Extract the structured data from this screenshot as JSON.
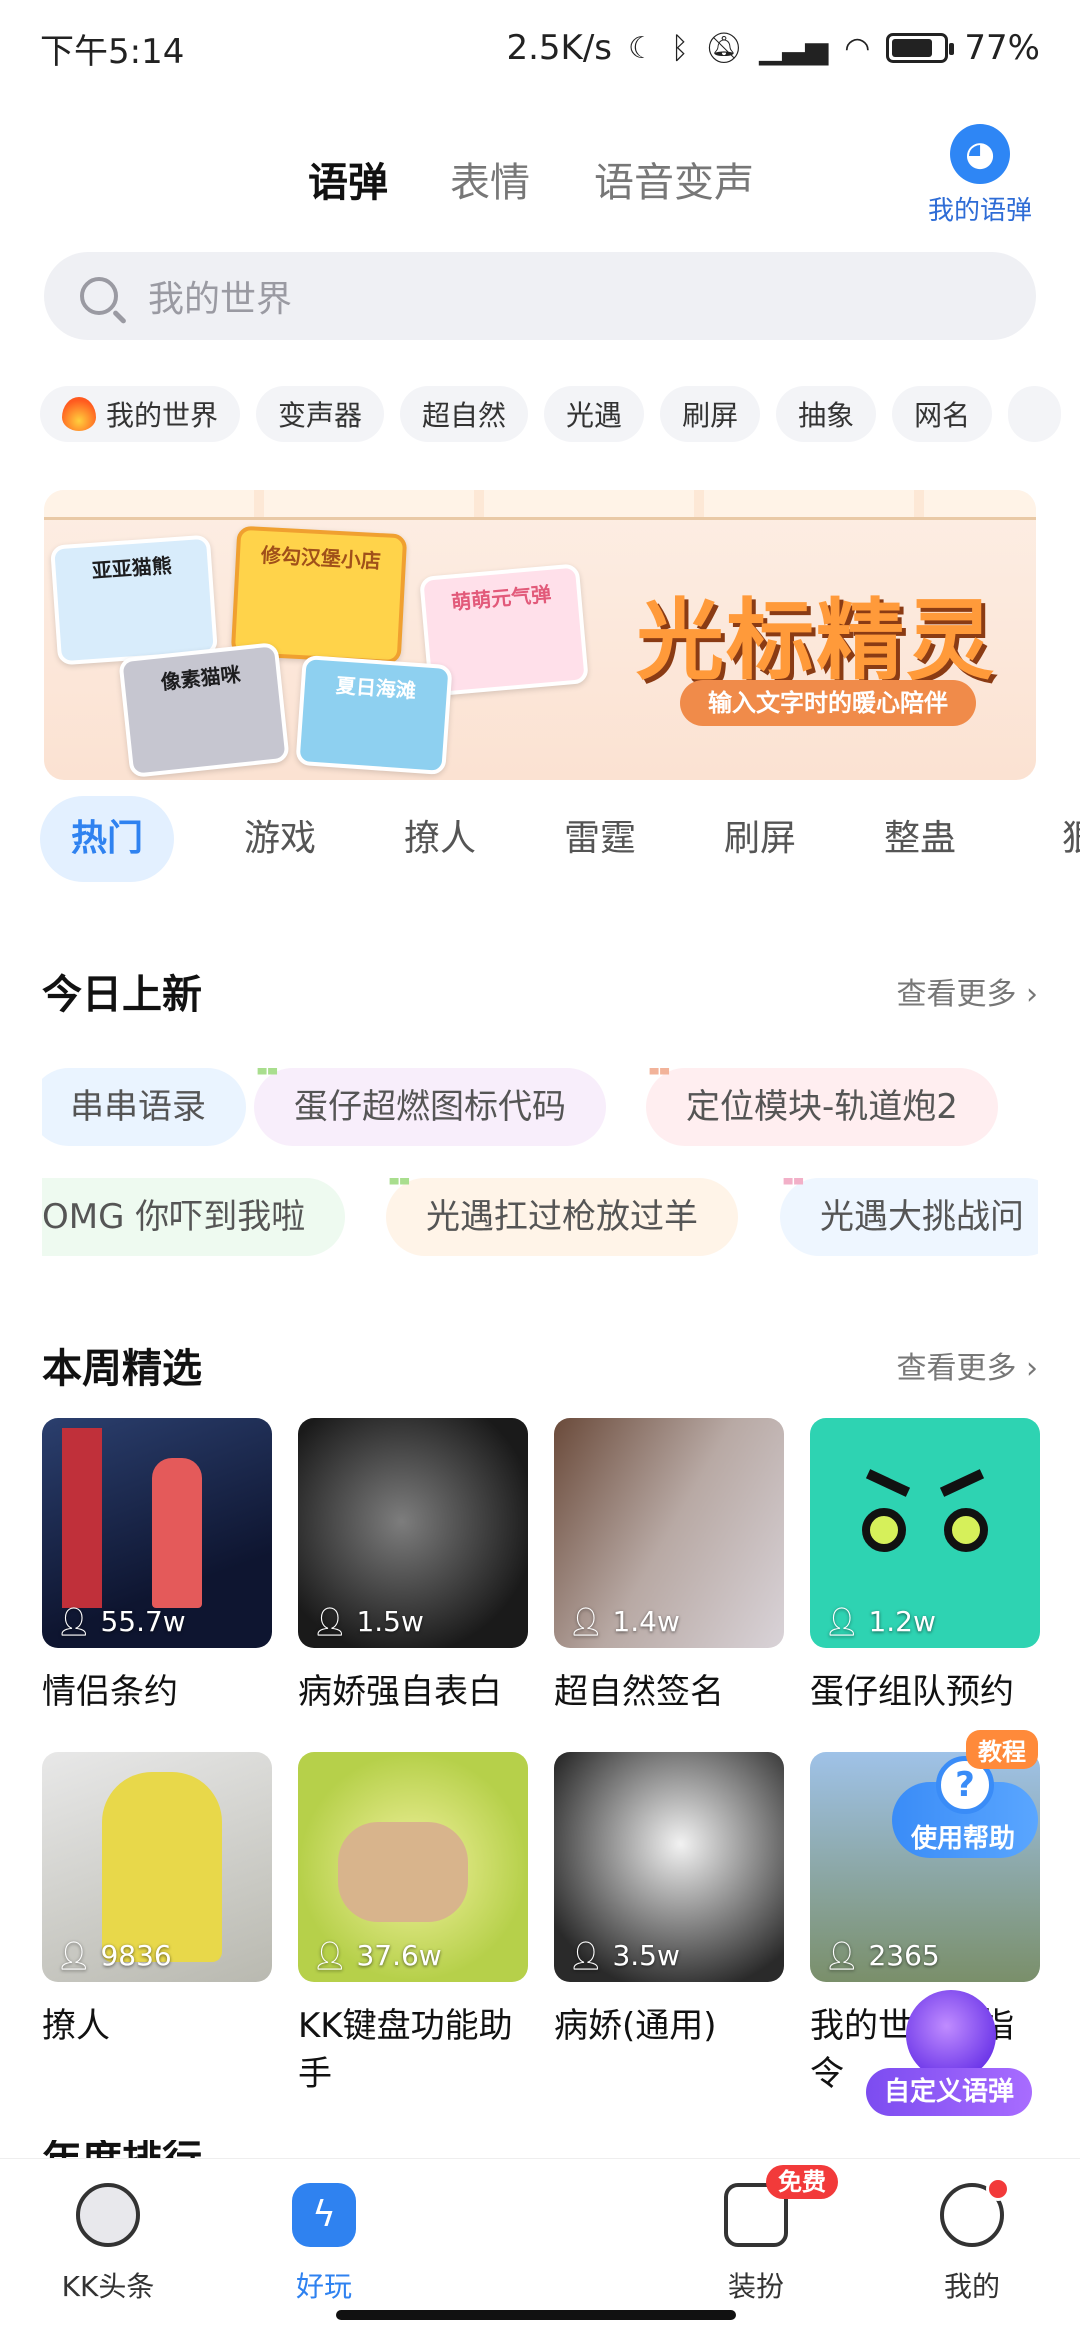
{
  "status_bar": {
    "time": "下午5:14",
    "speed": "2.5K/s",
    "battery": "77%",
    "battery_level": 0.77
  },
  "top_tabs": [
    "语弹",
    "表情",
    "语音变声"
  ],
  "my_voice_label": "我的语弹",
  "search": {
    "placeholder": "我的世界"
  },
  "chips": [
    "我的世界",
    "变声器",
    "超自然",
    "光遇",
    "刷屏",
    "抽象",
    "网名"
  ],
  "banner": {
    "title": "光标精灵",
    "subtitle": "输入文字时的暖心陪伴",
    "cards": [
      "亚亚猫熊",
      "修勾汉堡小店",
      "萌萌元气弹",
      "像素猫咪",
      "夏日海滩"
    ]
  },
  "category_tabs": [
    "热门",
    "游戏",
    "撩人",
    "雷霆",
    "刷屏",
    "整蛊",
    "狠"
  ],
  "today_new": {
    "title": "今日上新",
    "more": "查看更多",
    "row1": [
      "串串语录",
      "蛋仔超燃图标代码",
      "定位模块-轨道炮2"
    ],
    "row2": [
      "OMG 你吓到我啦",
      "光遇扛过枪放过羊",
      "光遇大挑战问"
    ]
  },
  "weekly": {
    "title": "本周精选",
    "more": "查看更多",
    "items": [
      {
        "count": "55.7w",
        "label": "情侣条约"
      },
      {
        "count": "1.5w",
        "label": "病娇强自表白"
      },
      {
        "count": "1.4w",
        "label": "超自然签名"
      },
      {
        "count": "1.2w",
        "label": "蛋仔组队预约"
      },
      {
        "count": "9836",
        "label": "撩人"
      },
      {
        "count": "37.6w",
        "label": "KK键盘功能助手"
      },
      {
        "count": "3.5w",
        "label": "病娇(通用)"
      },
      {
        "count": "2365",
        "label": "我的世界铁指令"
      }
    ]
  },
  "next_section_partial": "年度排行",
  "help_badge": {
    "tag": "教程",
    "label": "使用帮助"
  },
  "custom_float_label": "自定义语弹",
  "bottom_nav": {
    "items": [
      "KK头条",
      "好玩",
      "装扮",
      "我的"
    ],
    "free_badge": "免费"
  },
  "colors": {
    "accent": "#2f82f0",
    "highlight": "#ffd32a",
    "badge_red": "#f23a3a"
  }
}
